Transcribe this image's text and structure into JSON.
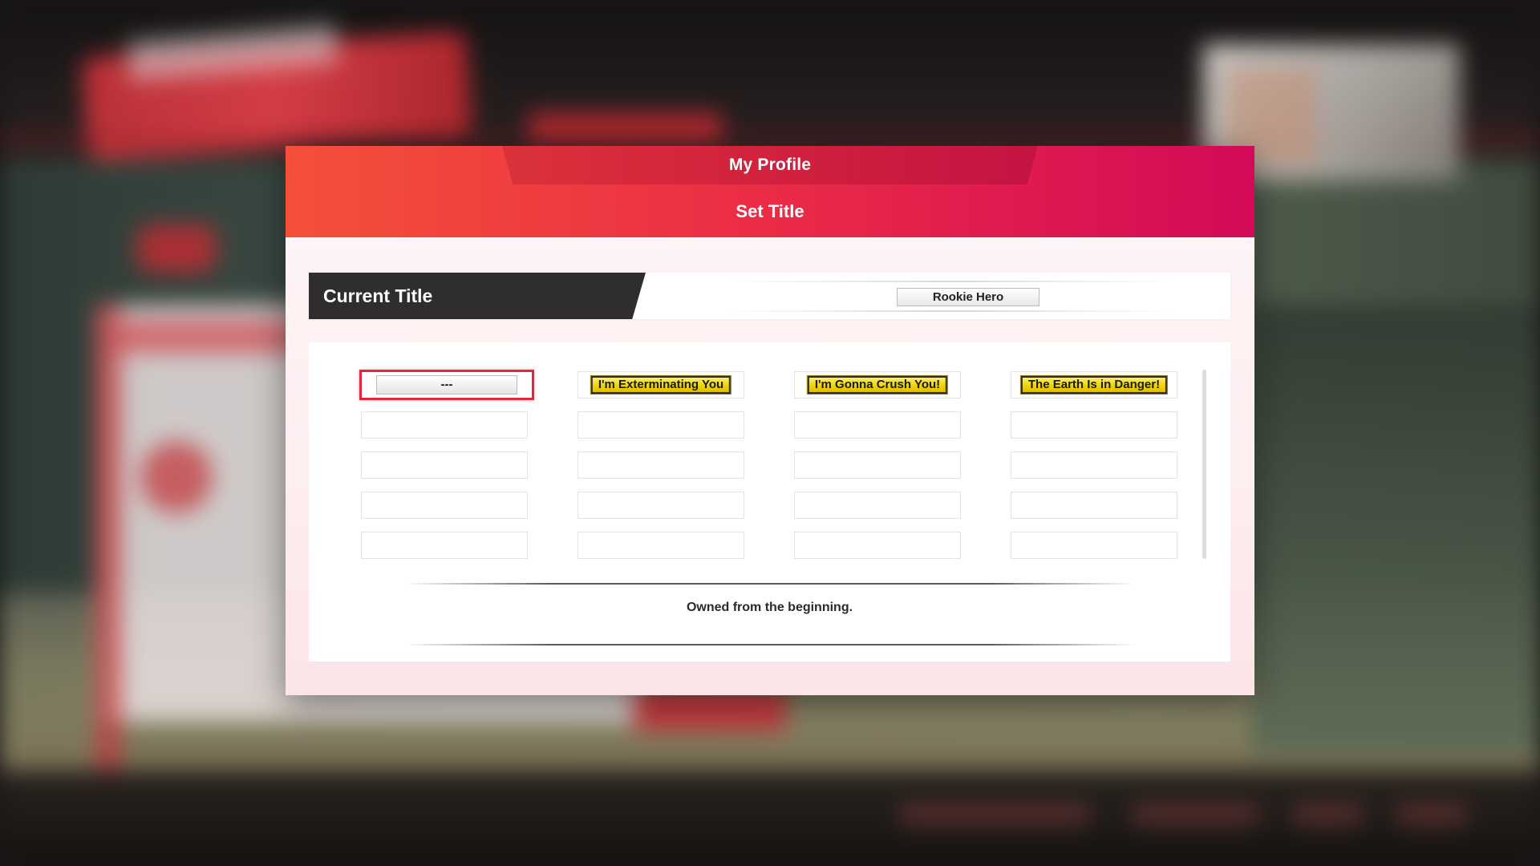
{
  "header": {
    "title": "My Profile",
    "subtitle": "Set Title"
  },
  "current": {
    "label": "Current Title",
    "value": "Rookie Hero"
  },
  "titles": [
    [
      {
        "text": "---",
        "style": "silver",
        "selected": true
      },
      {
        "text": "I'm Exterminating You",
        "style": "gold",
        "selected": false
      },
      {
        "text": "I'm Gonna Crush You!",
        "style": "gold",
        "selected": false
      },
      {
        "text": "The Earth Is in Danger!",
        "style": "gold",
        "selected": false
      }
    ],
    [
      {
        "text": "",
        "style": "empty"
      },
      {
        "text": "",
        "style": "empty"
      },
      {
        "text": "",
        "style": "empty"
      },
      {
        "text": "",
        "style": "empty"
      }
    ],
    [
      {
        "text": "",
        "style": "empty"
      },
      {
        "text": "",
        "style": "empty"
      },
      {
        "text": "",
        "style": "empty"
      },
      {
        "text": "",
        "style": "empty"
      }
    ],
    [
      {
        "text": "",
        "style": "empty"
      },
      {
        "text": "",
        "style": "empty"
      },
      {
        "text": "",
        "style": "empty"
      },
      {
        "text": "",
        "style": "empty"
      }
    ],
    [
      {
        "text": "",
        "style": "empty"
      },
      {
        "text": "",
        "style": "empty"
      },
      {
        "text": "",
        "style": "empty"
      },
      {
        "text": "",
        "style": "empty"
      }
    ]
  ],
  "description": "Owned from the beginning.",
  "colors": {
    "header_start": "#f5503a",
    "header_end": "#d30a58",
    "selection": "#e0273d",
    "gold_plate": "#f0d400",
    "label_bg": "#2f2d2f"
  }
}
